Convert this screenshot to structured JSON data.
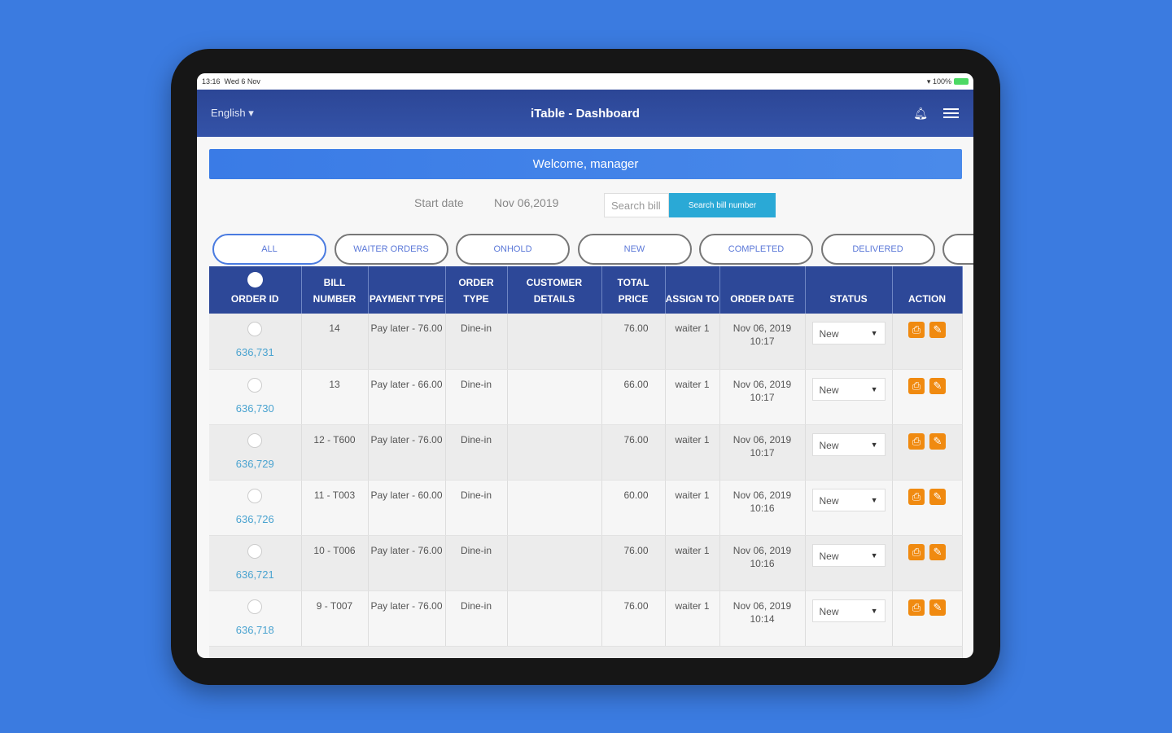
{
  "status_bar": {
    "time": "13:16",
    "date": "Wed 6 Nov",
    "battery": "100%"
  },
  "header": {
    "language": "English",
    "title": "iTable - Dashboard"
  },
  "welcome": "Welcome, manager",
  "filters": {
    "start_date_label": "Start date",
    "start_date_value": "Nov 06,2019",
    "search_placeholder": "Search bill",
    "search_button": "Search bill number"
  },
  "tabs": [
    "ALL",
    "WAITER ORDERS",
    "ONHOLD",
    "NEW",
    "COMPLETED",
    "DELIVERED"
  ],
  "columns": [
    "ORDER ID",
    "BILL NUMBER",
    "PAYMENT TYPE",
    "ORDER TYPE",
    "CUSTOMER DETAILS",
    "TOTAL PRICE",
    "ASSIGN TO",
    "ORDER DATE",
    "STATUS",
    "ACTION"
  ],
  "rows": [
    {
      "order_id": "636,731",
      "bill": "14",
      "payment": "Pay later - 76.00",
      "order_type": "Dine-in",
      "customer": "",
      "price": "76.00",
      "assign": "waiter 1",
      "date": "Nov 06, 2019 10:17",
      "status": "New"
    },
    {
      "order_id": "636,730",
      "bill": "13",
      "payment": "Pay later - 66.00",
      "order_type": "Dine-in",
      "customer": "",
      "price": "66.00",
      "assign": "waiter 1",
      "date": "Nov 06, 2019 10:17",
      "status": "New"
    },
    {
      "order_id": "636,729",
      "bill": "12 - T600",
      "payment": "Pay later - 76.00",
      "order_type": "Dine-in",
      "customer": "",
      "price": "76.00",
      "assign": "waiter 1",
      "date": "Nov 06, 2019 10:17",
      "status": "New"
    },
    {
      "order_id": "636,726",
      "bill": "11 - T003",
      "payment": "Pay later - 60.00",
      "order_type": "Dine-in",
      "customer": "",
      "price": "60.00",
      "assign": "waiter 1",
      "date": "Nov 06, 2019 10:16",
      "status": "New"
    },
    {
      "order_id": "636,721",
      "bill": "10 - T006",
      "payment": "Pay later - 76.00",
      "order_type": "Dine-in",
      "customer": "",
      "price": "76.00",
      "assign": "waiter 1",
      "date": "Nov 06, 2019 10:16",
      "status": "New"
    },
    {
      "order_id": "636,718",
      "bill": "9 - T007",
      "payment": "Pay later - 76.00",
      "order_type": "Dine-in",
      "customer": "",
      "price": "76.00",
      "assign": "waiter 1",
      "date": "Nov 06, 2019 10:14",
      "status": "New"
    }
  ],
  "colors": {
    "background": "#3b7be0",
    "header": "#2d4898",
    "accent": "#2aa9d6",
    "action": "#f08a10"
  }
}
